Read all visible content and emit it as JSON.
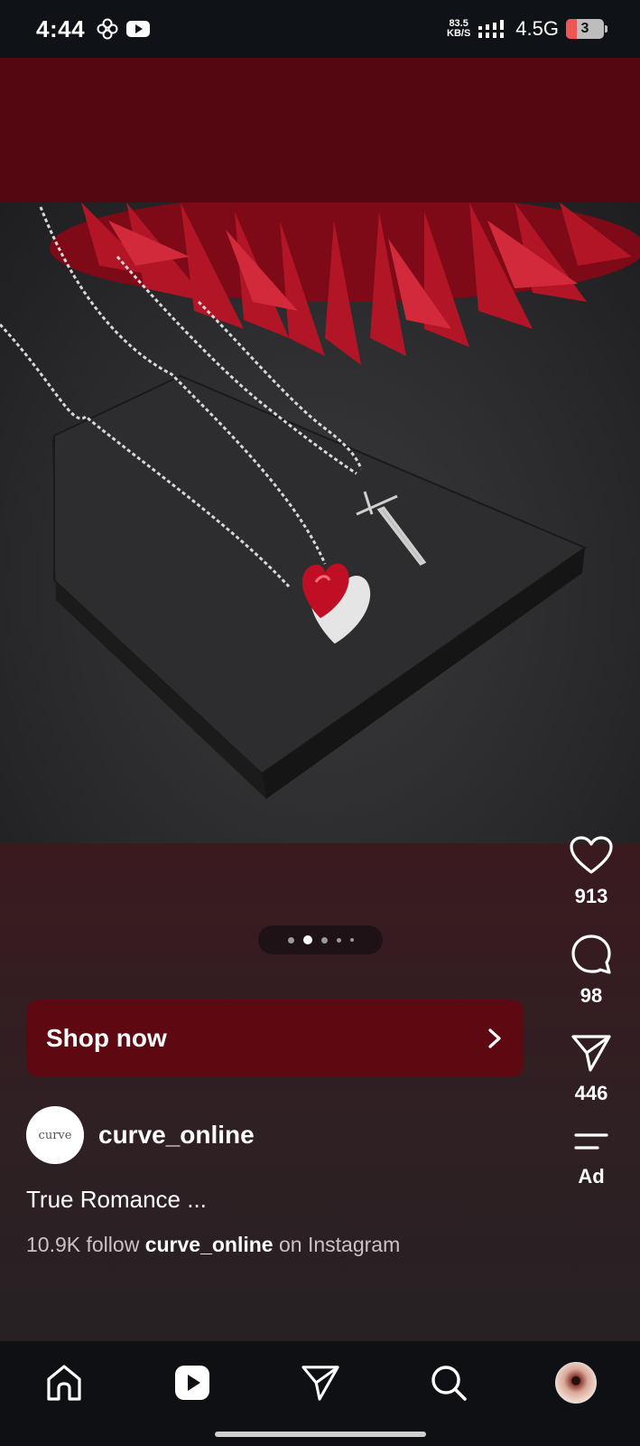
{
  "status_bar": {
    "time": "4:44",
    "net_speed_value": "83.5",
    "net_speed_unit": "KB/S",
    "network_type": "4.5G",
    "battery_level": "3"
  },
  "carousel": {
    "total": 5,
    "active_index": 1
  },
  "actions": {
    "likes": "913",
    "comments": "98",
    "shares": "446",
    "ad_label": "Ad"
  },
  "shop": {
    "label": "Shop now"
  },
  "account": {
    "avatar_text": "curve",
    "username": "curve_online"
  },
  "caption": {
    "text": "True Romance ..."
  },
  "follow": {
    "prefix": "10.9K follow ",
    "username": "curve_online",
    "suffix": " on Instagram"
  },
  "colors": {
    "accent": "#5e0812",
    "background_top": "#540710",
    "nav_bg": "#0f1014"
  },
  "nav": {
    "items": [
      "home-icon",
      "reels-icon",
      "direct-icon",
      "search-icon",
      "profile-avatar"
    ],
    "active": "reels-icon"
  }
}
